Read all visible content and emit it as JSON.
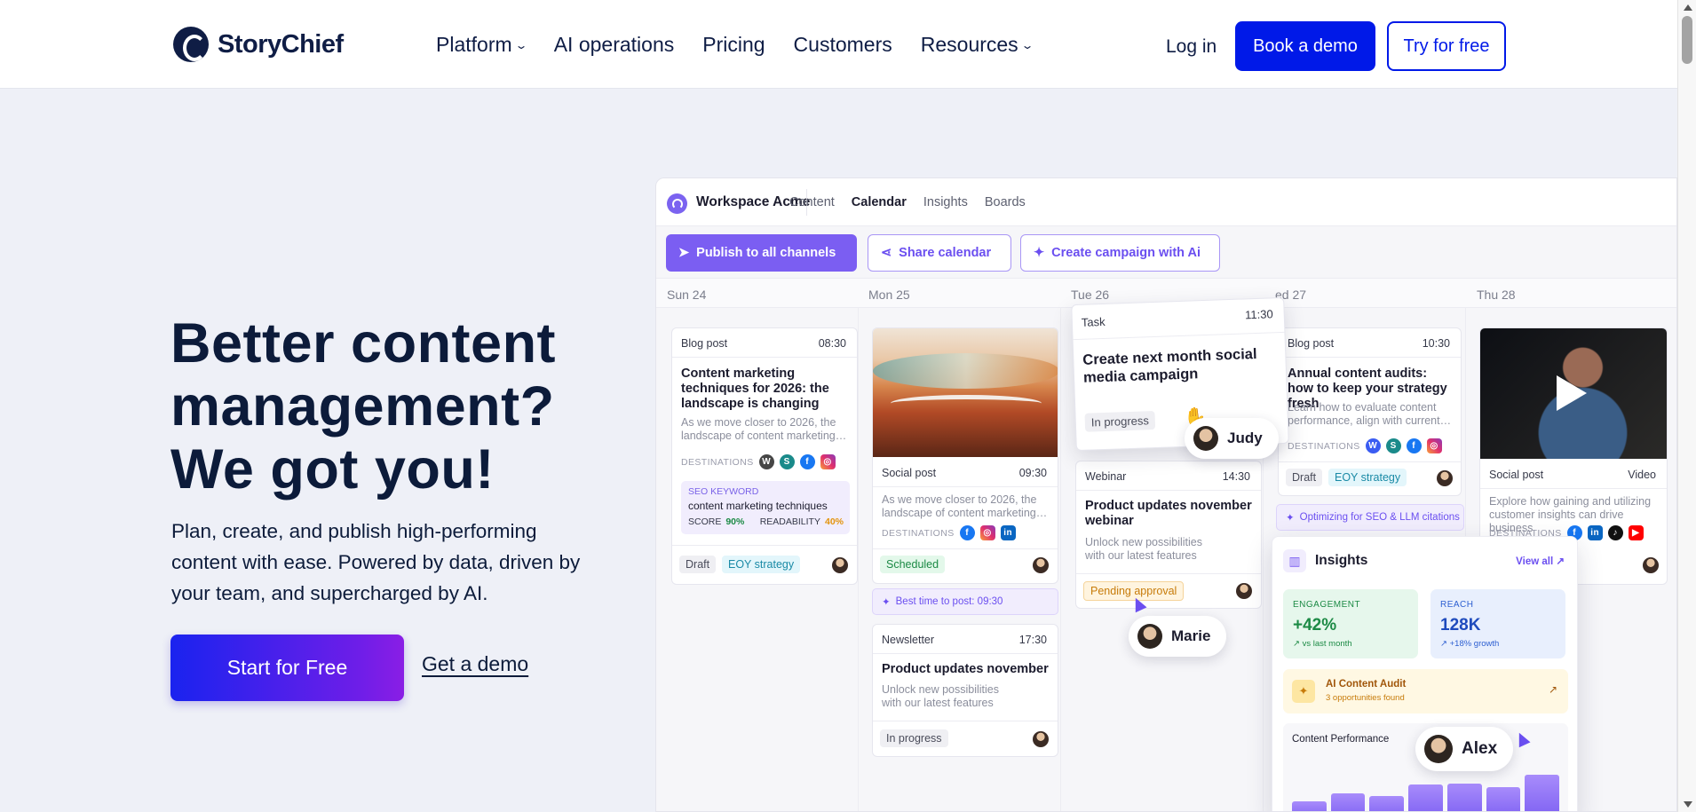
{
  "brand": {
    "name": "StoryChief"
  },
  "nav": {
    "items": [
      {
        "label": "Platform",
        "has_menu": true
      },
      {
        "label": "AI operations",
        "has_menu": false
      },
      {
        "label": "Pricing",
        "has_menu": false
      },
      {
        "label": "Customers",
        "has_menu": false
      },
      {
        "label": "Resources",
        "has_menu": true
      }
    ],
    "login": "Log in",
    "book_demo": "Book a demo",
    "try_free": "Try for free"
  },
  "hero": {
    "title_lines": [
      "Better content",
      "management?",
      "We got you!"
    ],
    "subtitle": "Plan, create, and publish high-performing content with ease. Powered by data, driven by your team, and supercharged by AI.",
    "cta_primary": "Start for Free",
    "cta_secondary": "Get a demo"
  },
  "app": {
    "workspace": "Workspace Acme",
    "tabs": [
      "Content",
      "Calendar",
      "Insights",
      "Boards"
    ],
    "active_tab": "Calendar",
    "buttons": {
      "publish": "Publish to all channels",
      "share": "Share calendar",
      "campaign": "Create campaign with Ai"
    },
    "days": [
      "Sun 24",
      "Mon 25",
      "Tue 26",
      "ed 27",
      "Thu 28"
    ],
    "cards": {
      "blog1": {
        "type": "Blog post",
        "time": "08:30",
        "title": "Content marketing techniques for 2026: the landscape is changing",
        "desc": "As we move closer to 2026, the landscape of content marketing…",
        "dest_label": "DESTINATIONS",
        "seo_label": "SEO KEYWORD",
        "seo_value": "content marketing techniques",
        "score_label": "SCORE",
        "score_value": "90%",
        "readability_label": "READABILITY",
        "readability_value": "40%",
        "status": "Draft",
        "campaign": "EOY strategy"
      },
      "social1": {
        "type": "Social post",
        "time": "09:30",
        "desc": "As we move closer to 2026, the landscape of content marketing…",
        "dest_label": "DESTINATIONS",
        "status": "Scheduled",
        "ai_hint": "Best time to post: 09:30"
      },
      "newsletter": {
        "type": "Newsletter",
        "time": "17:30",
        "title": "Product updates november",
        "desc": "Unlock new possibilities with our latest features",
        "status": "In progress"
      },
      "task": {
        "type": "Task",
        "time": "11:30",
        "title": "Create next month social media campaign",
        "status": "In progress",
        "assignee": "Judy"
      },
      "webinar": {
        "type": "Webinar",
        "time": "14:30",
        "title": "Product updates november webinar",
        "desc": "Unlock new possibilities with our latest features",
        "status": "Pending approval",
        "assignee": "Marie"
      },
      "blog2": {
        "type": "Blog post",
        "time": "10:30",
        "title": "Annual content audits: how to keep your strategy fresh",
        "desc": "Learn how to evaluate content performance, align with current…",
        "dest_label": "DESTINATIONS",
        "status": "Draft",
        "campaign": "EOY strategy",
        "ai_hint": "Optimizing for SEO & LLM citations"
      },
      "social2": {
        "type": "Social post",
        "time": "Video",
        "desc": "Explore how gaining and utilizing customer insights can drive business",
        "dest_label": "DESTINATIONS"
      }
    },
    "insights": {
      "title": "Insights",
      "view_all": "View all",
      "engagement_label": "ENGAGEMENT",
      "engagement_value": "+42%",
      "engagement_change": "vs last month",
      "reach_label": "REACH",
      "reach_value": "128K",
      "reach_change": "+18% growth",
      "audit_title": "AI Content Audit",
      "audit_sub": "3 opportunities found",
      "perf_title": "Content Performance",
      "perf_bars": [
        0.32,
        0.45,
        0.4,
        0.58,
        0.6,
        0.55,
        0.75
      ],
      "collaborator": "Alex"
    }
  },
  "colors": {
    "primary": "#0019e8",
    "accent": "#7b5ef2",
    "navy": "#0c1b3a"
  }
}
